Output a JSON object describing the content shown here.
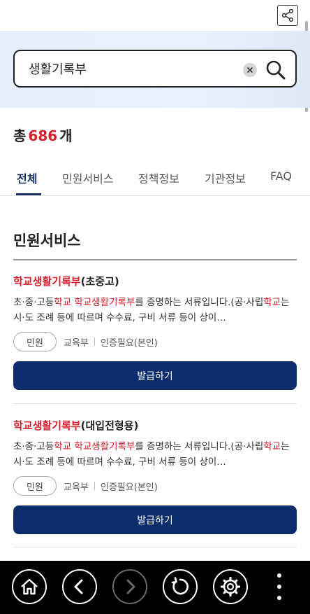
{
  "search": {
    "query": "생활기록부"
  },
  "results": {
    "label_prefix": "총",
    "count": "686",
    "label_suffix": "개"
  },
  "tabs": [
    {
      "label": "전체",
      "active": true
    },
    {
      "label": "민원서비스",
      "active": false
    },
    {
      "label": "정책정보",
      "active": false
    },
    {
      "label": "기관정보",
      "active": false
    },
    {
      "label": "FAQ",
      "active": false
    }
  ],
  "section": {
    "title": "민원서비스"
  },
  "cards": [
    {
      "title_hl": "학교생활기록부",
      "title_rest": "(초중고)",
      "desc_1": "초·중·고등",
      "desc_hl_1": "학교 학교생활기록부",
      "desc_2": "를 증명하는 서류입니다.(공·사립",
      "desc_hl_2": "학교",
      "desc_3": "는 시·도 조례 등에 따르며 수수료, 구비 서류 등이 상이…",
      "badge": "민원",
      "agency": "교육부",
      "auth": "인증필요(본인)",
      "button": "발급하기"
    },
    {
      "title_hl": "학교생활기록부",
      "title_rest": "(대입전형용)",
      "desc_1": "초·중·고등",
      "desc_hl_1": "학교 학교생활기록부",
      "desc_2": "를 증명하는 서류입니다.(공·사립",
      "desc_hl_2": "학교",
      "desc_3": "는 시·도 조례 등에 따르며 수수료, 구비 서류 등이 상이…",
      "badge": "민원",
      "agency": "교육부",
      "auth": "인증필요(본인)",
      "button": "발급하기"
    }
  ],
  "nav": {
    "home": "home-icon",
    "back": "chevron-left-icon",
    "forward": "chevron-right-icon",
    "refresh": "refresh-icon",
    "settings": "gear-icon",
    "more": "more-vertical-icon"
  },
  "colors": {
    "highlight": "#d6202b",
    "primary": "#0c2d6b",
    "tab_active": "#16305f"
  }
}
